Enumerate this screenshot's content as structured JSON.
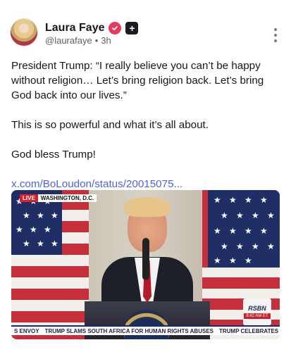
{
  "post": {
    "author": {
      "display_name": "Laura Faye",
      "handle": "@laurafaye",
      "separator": "•",
      "time_ago": "3h",
      "verified_icon": "heart-check-icon",
      "plus_icon": "plus-icon",
      "accent_color": "#e8395f"
    },
    "menu_icon": "more-vertical-icon",
    "text": {
      "paragraph1": "President Trump: “I really believe you can’t be happy without religion… Let’s bring religion back. Let’s bring God back into our lives.”",
      "paragraph2": "This is so powerful and what it’s all about.",
      "paragraph3": "God bless Trump!",
      "link": "x.com/BoLoudon/status/20015075..."
    },
    "link_color": "#4f62e0",
    "video": {
      "live_label": "LIVE",
      "location_label": "WASHINGTON, D.C.",
      "network_logo": "RSBN",
      "network_time": "8:42 AM ET",
      "ticker": [
        "S ENVOY",
        "TRUMP SLAMS SOUTH AFRICA FOR HUMAN RIGHTS ABUSES",
        "TRUMP CELEBRATES R"
      ]
    }
  }
}
